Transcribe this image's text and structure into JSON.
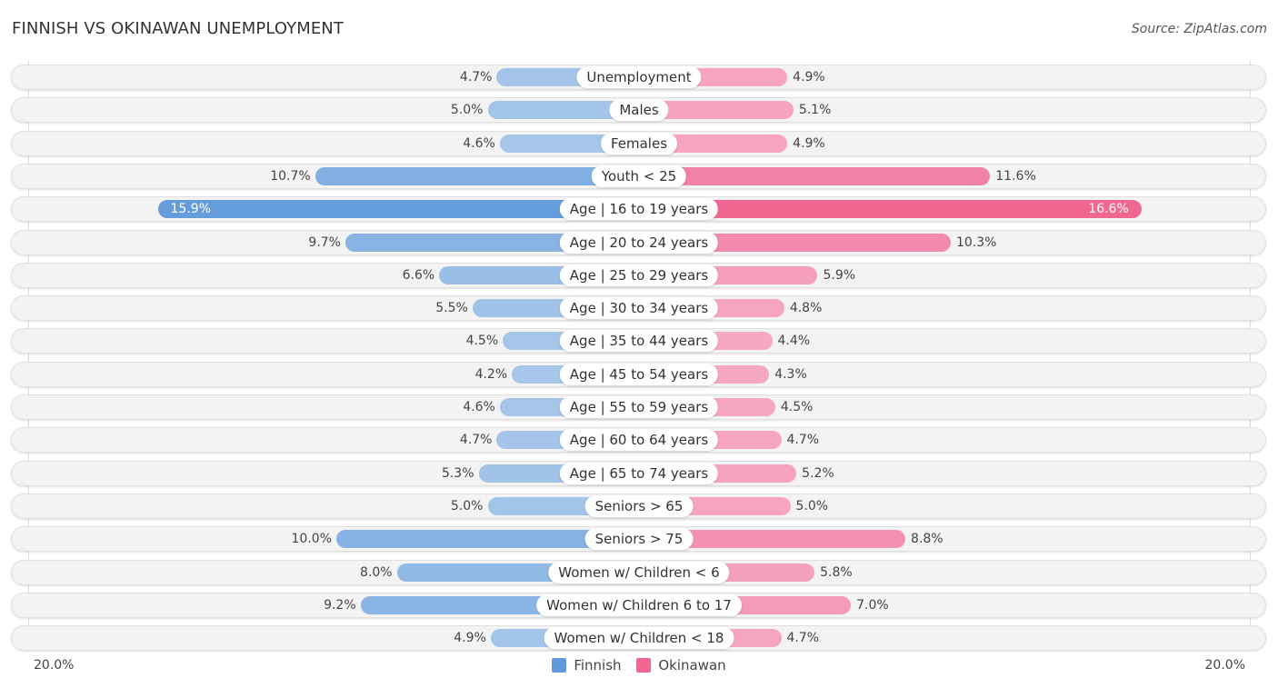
{
  "header": {
    "title": "FINNISH VS OKINAWAN UNEMPLOYMENT",
    "source": "Source: ZipAtlas.com"
  },
  "colors": {
    "finnish_light": "#a8c8ea",
    "finnish_strong": "#6199db",
    "okinawan_light": "#f6a9c3",
    "okinawan_strong": "#f06892"
  },
  "chart_data": {
    "type": "bar",
    "orientation": "horizontal-diverging",
    "title": "FINNISH VS OKINAWAN UNEMPLOYMENT",
    "xlim": [
      -20,
      20
    ],
    "axis_labels": {
      "left": "20.0%",
      "right": "20.0%"
    },
    "legend": {
      "position": "bottom-center",
      "entries": [
        "Finnish",
        "Okinawan"
      ]
    },
    "categories": [
      "Unemployment",
      "Males",
      "Females",
      "Youth < 25",
      "Age | 16 to 19 years",
      "Age | 20 to 24 years",
      "Age | 25 to 29 years",
      "Age | 30 to 34 years",
      "Age | 35 to 44 years",
      "Age | 45 to 54 years",
      "Age | 55 to 59 years",
      "Age | 60 to 64 years",
      "Age | 65 to 74 years",
      "Seniors > 65",
      "Seniors > 75",
      "Women w/ Children < 6",
      "Women w/ Children 6 to 17",
      "Women w/ Children < 18"
    ],
    "series": [
      {
        "name": "Finnish",
        "side": "left",
        "values": [
          4.7,
          5.0,
          4.6,
          10.7,
          15.9,
          9.7,
          6.6,
          5.5,
          4.5,
          4.2,
          4.6,
          4.7,
          5.3,
          5.0,
          10.0,
          8.0,
          9.2,
          4.9
        ],
        "labels": [
          "4.7%",
          "5.0%",
          "4.6%",
          "10.7%",
          "15.9%",
          "9.7%",
          "6.6%",
          "5.5%",
          "4.5%",
          "4.2%",
          "4.6%",
          "4.7%",
          "5.3%",
          "5.0%",
          "10.0%",
          "8.0%",
          "9.2%",
          "4.9%"
        ]
      },
      {
        "name": "Okinawan",
        "side": "right",
        "values": [
          4.9,
          5.1,
          4.9,
          11.6,
          16.6,
          10.3,
          5.9,
          4.8,
          4.4,
          4.3,
          4.5,
          4.7,
          5.2,
          5.0,
          8.8,
          5.8,
          7.0,
          4.7
        ],
        "labels": [
          "4.9%",
          "5.1%",
          "4.9%",
          "11.6%",
          "16.6%",
          "10.3%",
          "5.9%",
          "4.8%",
          "4.4%",
          "4.3%",
          "4.5%",
          "4.7%",
          "5.2%",
          "5.0%",
          "8.8%",
          "5.8%",
          "7.0%",
          "4.7%"
        ]
      }
    ]
  }
}
